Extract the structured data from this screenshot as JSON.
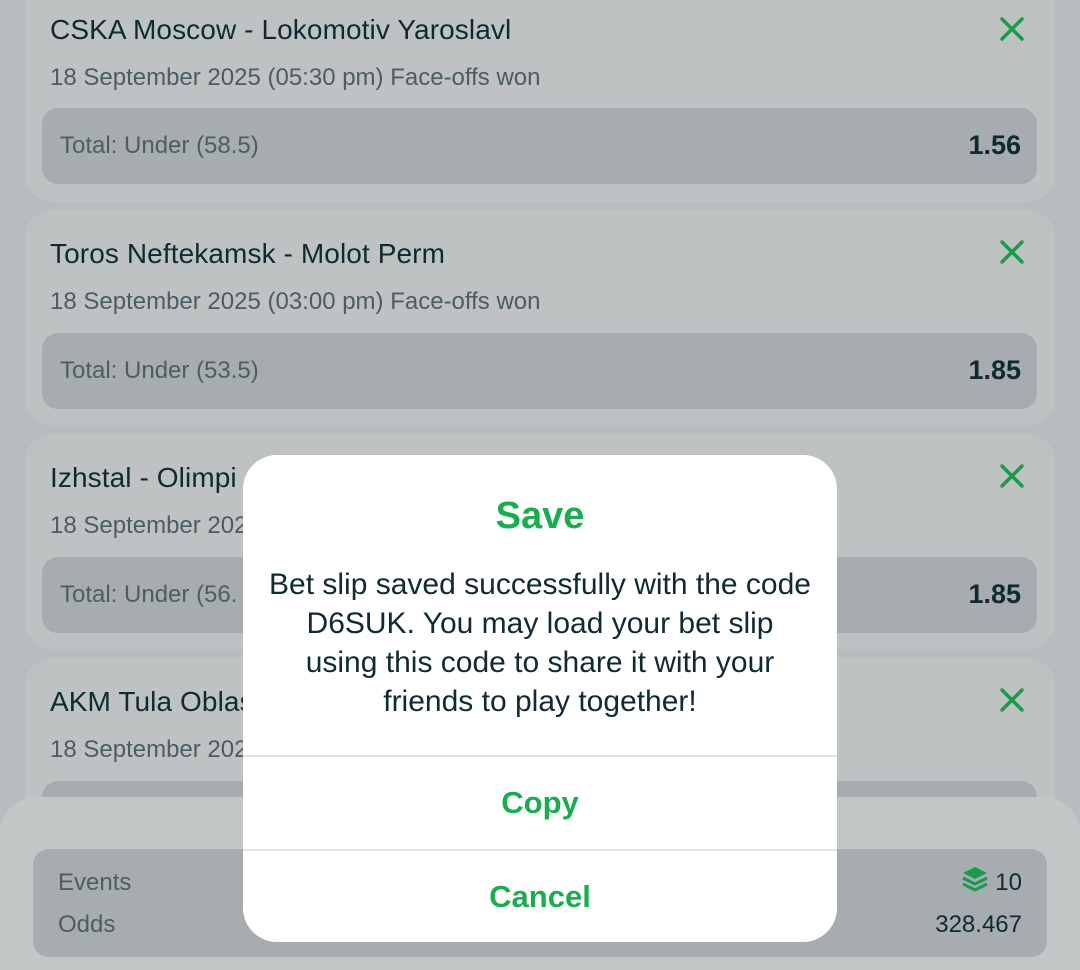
{
  "colors": {
    "accent": "#19ad4e",
    "dark_text": "#0f2a30",
    "overlay_bg": "#b7bcbe"
  },
  "bets": [
    {
      "match": "CSKA Moscow - Lokomotiv Yaroslavl",
      "date": "18 September 2025 (05:30 pm) Face-offs won",
      "market": "Total: Under (58.5)",
      "odds": "1.56",
      "remove_icon": "close-x-icon"
    },
    {
      "match": "Toros Neftekamsk - Molot Perm",
      "date": "18 September 2025 (03:00 pm) Face-offs won",
      "market": "Total: Under (53.5)",
      "odds": "1.85",
      "remove_icon": "close-x-icon"
    },
    {
      "match": "Izhstal - Olimpi",
      "date": "18 September 202",
      "market": "Total: Under (56.",
      "odds": "1.85",
      "remove_icon": "close-x-icon"
    },
    {
      "match": "AKM Tula Oblas",
      "date": "18 September 202",
      "remove_icon": "close-x-icon"
    }
  ],
  "summary": {
    "events_label": "Events",
    "events_value": "10",
    "events_icon": "layers-stack-icon",
    "odds_label": "Odds",
    "odds_value": "328.467"
  },
  "dialog": {
    "title": "Save",
    "message": "Bet slip saved successfully with the code D6SUK. You may load your bet slip using this code to share it with your friends to play together!",
    "copy_label": "Copy",
    "cancel_label": "Cancel"
  }
}
